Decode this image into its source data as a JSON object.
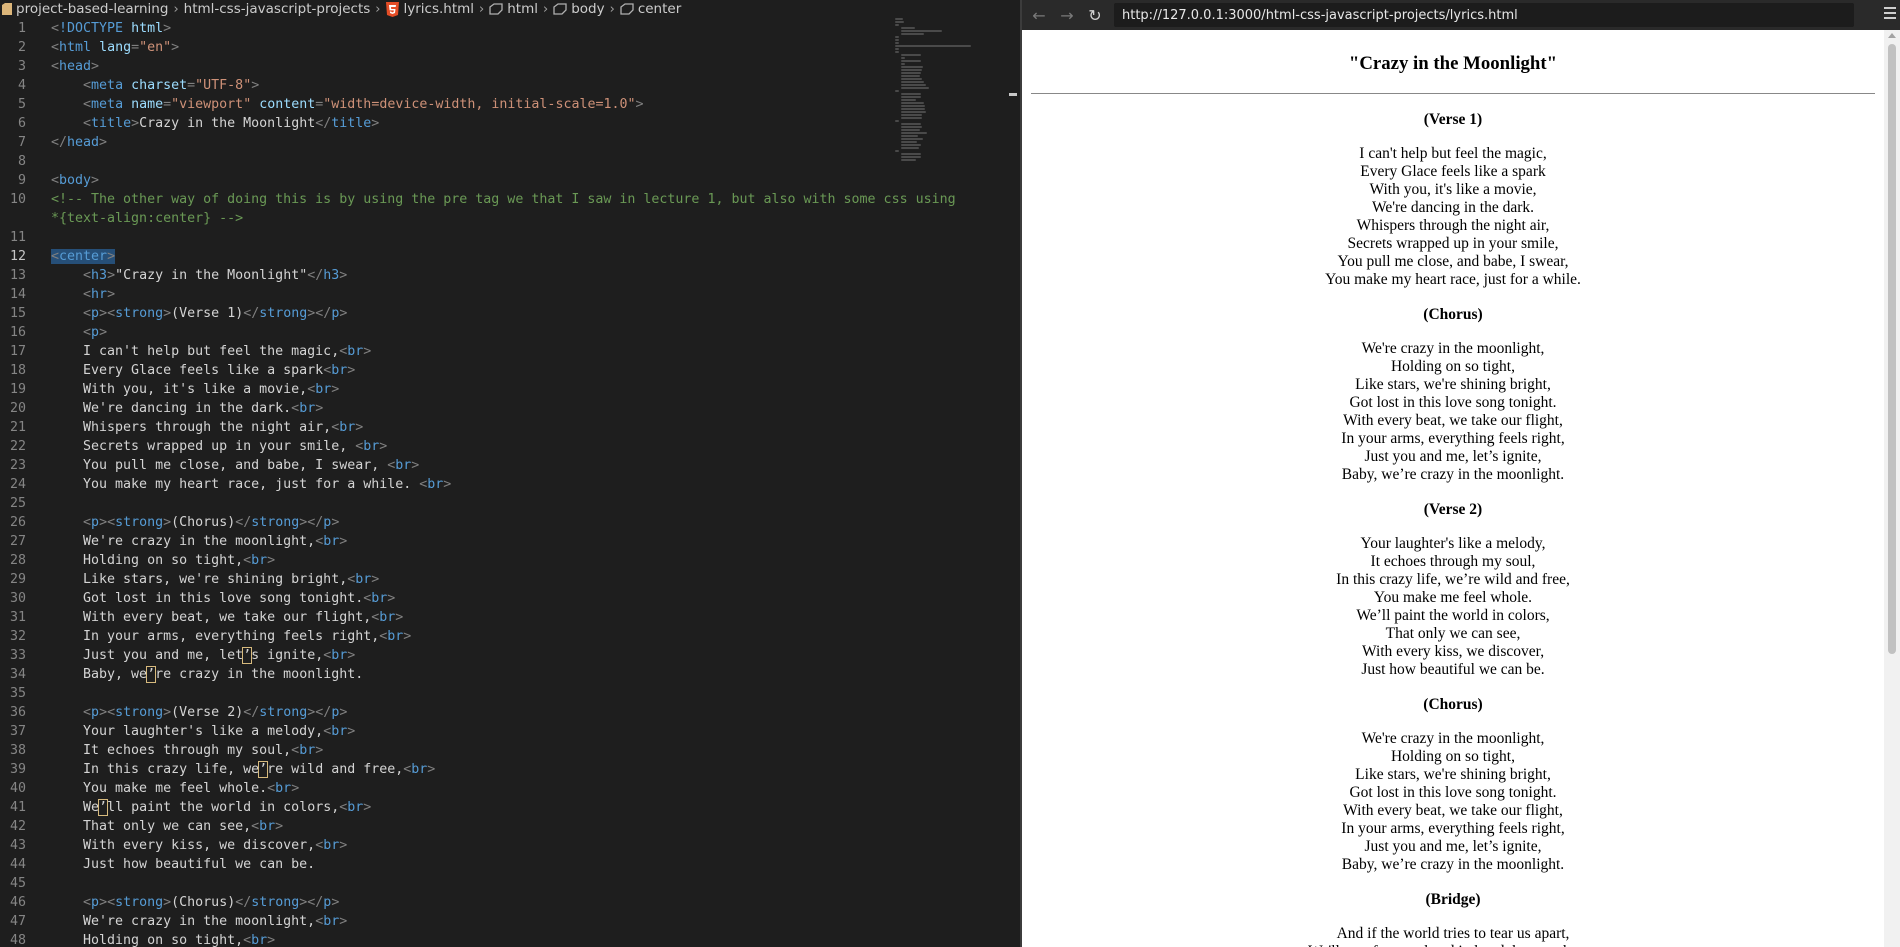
{
  "editor": {
    "breadcrumb": {
      "folder1": "project-based-learning",
      "folder2": "html-css-javascript-projects",
      "file": "lyrics.html",
      "el1": "html",
      "el2": "body",
      "el3": "center"
    },
    "active_line": 12,
    "lines": [
      "<!DOCTYPE html>",
      "<html lang=\"en\">",
      "<head>",
      "    <meta charset=\"UTF-8\">",
      "    <meta name=\"viewport\" content=\"width=device-width, initial-scale=1.0\">",
      "    <title>Crazy in the Moonlight</title>",
      "</head>",
      "",
      "<body>",
      "<!-- The other way of doing this is by using the pre tag we that I saw in lecture 1, but also with some css using *{text-align:center} -->",
      "",
      "<center>",
      "    <h3>\"Crazy in the Moonlight\"</h3>",
      "    <hr>",
      "    <p><strong>(Verse 1)</strong></p>",
      "    <p>",
      "    I can't help but feel the magic,<br>",
      "    Every Glace feels like a spark<br>",
      "    With you, it's like a movie,<br>",
      "    We're dancing in the dark.<br>",
      "    Whispers through the night air,<br>",
      "    Secrets wrapped up in your smile, <br>",
      "    You pull me close, and babe, I swear, <br>",
      "    You make my heart race, just for a while. <br>",
      "",
      "    <p><strong>(Chorus)</strong></p>",
      "    We're crazy in the moonlight,<br>",
      "    Holding on so tight,<br>",
      "    Like stars, we're shining bright,<br>",
      "    Got lost in this love song tonight.<br>",
      "    With every beat, we take our flight,<br>",
      "    In your arms, everything feels right,<br>",
      "    Just you and me, let’s ignite,<br>",
      "    Baby, we’re crazy in the moonlight.",
      "",
      "    <p><strong>(Verse 2)</strong></p>",
      "    Your laughter's like a melody,<br>",
      "    It echoes through my soul,<br>",
      "    In this crazy life, we’re wild and free,<br>",
      "    You make me feel whole.<br>",
      "    We’ll paint the world in colors,<br>",
      "    That only we can see,<br>",
      "    With every kiss, we discover,<br>",
      "    Just how beautiful we can be.",
      "",
      "    <p><strong>(Chorus)</strong></p>",
      "    We're crazy in the moonlight,<br>",
      "    Holding on so tight,<br>"
    ]
  },
  "browser": {
    "url": "http://127.0.0.1:3000/html-css-javascript-projects/lyrics.html",
    "title": "\"Crazy in the Moonlight\"",
    "sections": [
      {
        "title": "(Verse 1)",
        "lines": [
          "I can't help but feel the magic,",
          "Every Glace feels like a spark",
          "With you, it's like a movie,",
          "We're dancing in the dark.",
          "Whispers through the night air,",
          "Secrets wrapped up in your smile,",
          "You pull me close, and babe, I swear,",
          "You make my heart race, just for a while."
        ]
      },
      {
        "title": "(Chorus)",
        "lines": [
          "We're crazy in the moonlight,",
          "Holding on so tight,",
          "Like stars, we're shining bright,",
          "Got lost in this love song tonight.",
          "With every beat, we take our flight,",
          "In your arms, everything feels right,",
          "Just you and me, let’s ignite,",
          "Baby, we’re crazy in the moonlight."
        ]
      },
      {
        "title": "(Verse 2)",
        "lines": [
          "Your laughter's like a melody,",
          "It echoes through my soul,",
          "In this crazy life, we’re wild and free,",
          "You make me feel whole.",
          "We’ll paint the world in colors,",
          "That only we can see,",
          "With every kiss, we discover,",
          "Just how beautiful we can be."
        ]
      },
      {
        "title": "(Chorus)",
        "lines": [
          "We're crazy in the moonlight,",
          "Holding on so tight,",
          "Like stars, we're shining bright,",
          "Got lost in this love song tonight.",
          "With every beat, we take our flight,",
          "In your arms, everything feels right,",
          "Just you and me, let’s ignite,",
          "Baby, we’re crazy in the moonlight."
        ]
      },
      {
        "title": "(Bridge)",
        "lines": [
          "And if the world tries to tear us apart,",
          "We'll stay forever, hand in hand, heart to heart,"
        ]
      }
    ]
  },
  "colors": {
    "editor_bg": "#1e1e1e",
    "tag": "#569cd6",
    "attribute": "#9cdcfe",
    "string": "#ce9178",
    "comment": "#6a9955",
    "selection": "#264f78"
  },
  "icons": [
    "folder-icon",
    "html5-file-icon",
    "element-tag-icon",
    "back-arrow-icon",
    "forward-arrow-icon",
    "reload-icon",
    "menu-icon"
  ]
}
